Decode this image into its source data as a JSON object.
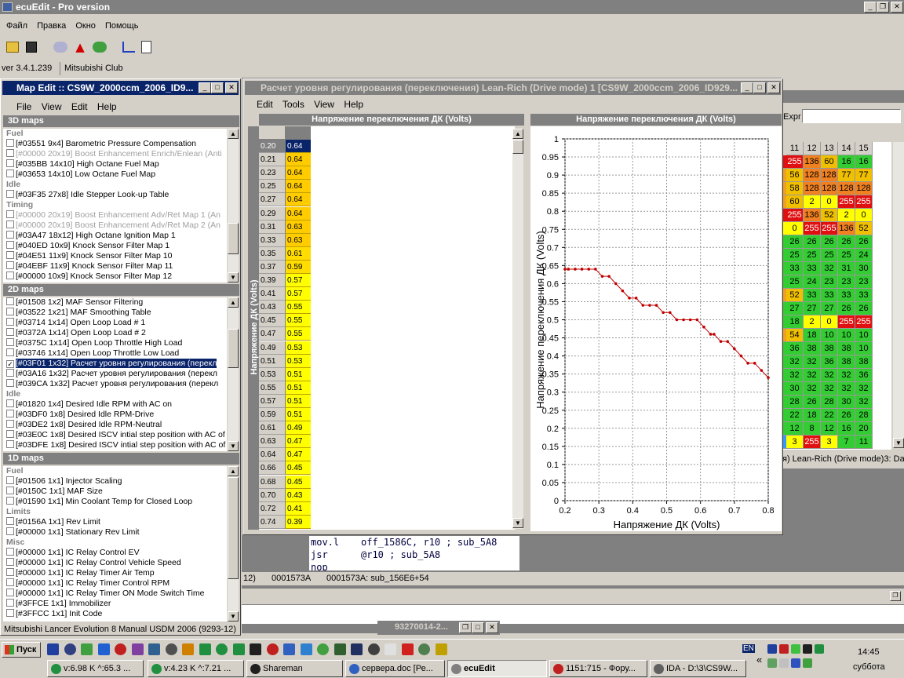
{
  "app": {
    "title": "ecuEdit - Pro version",
    "menu": [
      "Файл",
      "Правка",
      "Окно",
      "Помощь"
    ],
    "version": "ver 3.4.1.239",
    "club": "Mitsubishi Club"
  },
  "map_window": {
    "title": "Map Edit :: CS9W_2000ccm_2006_ID9...",
    "menu": [
      "File",
      "View",
      "Edit",
      "Help"
    ],
    "sections": {
      "s3d": "3D maps",
      "s2d": "2D maps",
      "s1d": "1D maps"
    },
    "maps3d": [
      {
        "g": "Fuel"
      },
      {
        "t": "[#03551 9x4] Barometric Pressure Compensation"
      },
      {
        "t": "[#00000 20x19] Boost Enhancement Enrich/Enlean (Anti",
        "d": true
      },
      {
        "t": "[#035BB 14x10] High Octane Fuel Map"
      },
      {
        "t": "[#03653 14x10] Low Octane Fuel Map"
      },
      {
        "g": "Idle"
      },
      {
        "t": "[#03F35 27x8] Idle Stepper Look-up Table"
      },
      {
        "g": "Timing"
      },
      {
        "t": "[#00000 20x19] Boost Enhancement Adv/Ret Map 1 (An",
        "d": true
      },
      {
        "t": "[#00000 20x19] Boost Enhancement Adv/Ret Map 2 (An",
        "d": true
      },
      {
        "t": "[#03A47 18x12] High Octane Ignition Map 1"
      },
      {
        "t": "[#040ED 10x9] Knock Sensor Filter Map 1"
      },
      {
        "t": "[#04E51 11x9] Knock Sensor Filter Map 10"
      },
      {
        "t": "[#04EBF 11x9] Knock Sensor Filter Map 11"
      },
      {
        "t": "[#00000 10x9] Knock Sensor Filter Map 12"
      }
    ],
    "maps2d": [
      {
        "t": "[#01508 1x2] MAF Sensor Filtering"
      },
      {
        "t": "[#03522 1x21] MAF Smoothing Table"
      },
      {
        "t": "[#03714 1x14] Open Loop Load # 1"
      },
      {
        "t": "[#0372A 1x14] Open Loop Load # 2"
      },
      {
        "t": "[#0375C 1x14] Open Loop Throttle High Load"
      },
      {
        "t": "[#03746 1x14] Open Loop Throttle Low Load"
      },
      {
        "t": "[#03F01 1x32] Расчет уровня регулирования (перекл",
        "c": true,
        "s": true
      },
      {
        "t": "[#03A16 1x32] Расчет уровня регулирования (перекл"
      },
      {
        "t": "[#039CA 1x32] Расчет уровня регулирования (перекл"
      },
      {
        "g": "Idle"
      },
      {
        "t": "[#01820 1x4] Desired Idle RPM with AC on"
      },
      {
        "t": "[#03DF0 1x8] Desired Idle RPM-Drive"
      },
      {
        "t": "[#03DE2 1x8] Desired Idle RPM-Neutral"
      },
      {
        "t": "[#03E0C 1x8] Desired ISCV intial step position with AC of"
      },
      {
        "t": "[#03DFE 1x8] Desired ISCV intial step position with AC of"
      }
    ],
    "maps1d": [
      {
        "g": "Fuel"
      },
      {
        "t": "[#01506 1x1] Injector Scaling"
      },
      {
        "t": "[#0150C 1x1] MAF Size"
      },
      {
        "t": "[#01590 1x1] Min Coolant Temp for Closed Loop"
      },
      {
        "g": "Limits"
      },
      {
        "t": "[#0156A 1x1] Rev Limit"
      },
      {
        "t": "[#00000 1x1] Stationary Rev Limit"
      },
      {
        "g": "Misc"
      },
      {
        "t": "[#00000 1x1] IC Relay Control EV"
      },
      {
        "t": "[#00000 1x1] IC Relay Control Vehicle Speed"
      },
      {
        "t": "[#00000 1x1] IC Relay Timer Air Temp"
      },
      {
        "t": "[#00000 1x1] IC Relay Timer Control RPM"
      },
      {
        "t": "[#00000 1x1] IC Relay Timer ON Mode Switch Time"
      },
      {
        "t": "[#3FFCE 1x1] Immobilizer"
      },
      {
        "t": "[#3FFCC 1x1] Init Code"
      }
    ],
    "status": "Mitsubishi Lancer Evolution 8 Manual USDM 2006 (9293-12)"
  },
  "main_window": {
    "title": "Расчет уровня регулирования (переключения) Lean-Rich (Drive mode) 1 [CS9W_2000ccm_2006_ID929...",
    "menu": [
      "Edit",
      "Tools",
      "View",
      "Help"
    ],
    "table_header": "Напряжение переключения ДК (Volts)",
    "row_axis_label": "Напряжение ДК (Volts)",
    "rows": [
      [
        "0.20",
        "0.64"
      ],
      [
        "0.21",
        "0.64"
      ],
      [
        "0.23",
        "0.64"
      ],
      [
        "0.25",
        "0.64"
      ],
      [
        "0.27",
        "0.64"
      ],
      [
        "0.29",
        "0.64"
      ],
      [
        "0.31",
        "0.63"
      ],
      [
        "0.33",
        "0.63"
      ],
      [
        "0.35",
        "0.61"
      ],
      [
        "0.37",
        "0.59"
      ],
      [
        "0.39",
        "0.57"
      ],
      [
        "0.41",
        "0.57"
      ],
      [
        "0.43",
        "0.55"
      ],
      [
        "0.45",
        "0.55"
      ],
      [
        "0.47",
        "0.55"
      ],
      [
        "0.49",
        "0.53"
      ],
      [
        "0.51",
        "0.53"
      ],
      [
        "0.53",
        "0.51"
      ],
      [
        "0.55",
        "0.51"
      ],
      [
        "0.57",
        "0.51"
      ],
      [
        "0.59",
        "0.51"
      ],
      [
        "0.61",
        "0.49"
      ],
      [
        "0.63",
        "0.47"
      ],
      [
        "0.64",
        "0.47"
      ],
      [
        "0.66",
        "0.45"
      ],
      [
        "0.68",
        "0.45"
      ],
      [
        "0.70",
        "0.43"
      ],
      [
        "0.72",
        "0.41"
      ],
      [
        "0.74",
        "0.39"
      ]
    ]
  },
  "chart_data": {
    "type": "line",
    "title": "Напряжение переключения ДК (Volts)",
    "xlabel": "Напряжение ДК (Volts)",
    "ylabel": "Напряжение переключения ДК (Volts)",
    "xlim": [
      0.2,
      0.8
    ],
    "ylim": [
      0,
      1
    ],
    "grid": true,
    "xticks": [
      "0.2",
      "0.3",
      "0.4",
      "0.5",
      "0.6",
      "0.7",
      "0.8"
    ],
    "yticks": [
      "0",
      "0.05",
      "0.1",
      "0.15",
      "0.2",
      "0.25",
      "0.3",
      "0.35",
      "0.4",
      "0.45",
      "0.5",
      "0.55",
      "0.6",
      "0.65",
      "0.7",
      "0.75",
      "0.8",
      "0.85",
      "0.9",
      "0.95",
      "1"
    ],
    "x": [
      0.2,
      0.21,
      0.23,
      0.25,
      0.27,
      0.29,
      0.31,
      0.33,
      0.35,
      0.37,
      0.39,
      0.41,
      0.43,
      0.45,
      0.47,
      0.49,
      0.51,
      0.53,
      0.55,
      0.57,
      0.59,
      0.61,
      0.63,
      0.64,
      0.66,
      0.68,
      0.7,
      0.72,
      0.74,
      0.76,
      0.78,
      0.8
    ],
    "y": [
      0.64,
      0.64,
      0.64,
      0.64,
      0.64,
      0.64,
      0.62,
      0.62,
      0.6,
      0.58,
      0.56,
      0.56,
      0.54,
      0.54,
      0.54,
      0.52,
      0.52,
      0.5,
      0.5,
      0.5,
      0.5,
      0.48,
      0.46,
      0.46,
      0.44,
      0.44,
      0.42,
      0.4,
      0.38,
      0.38,
      0.36,
      0.34
    ],
    "line_color": "#c00000"
  },
  "hex_grid": {
    "cols": [
      "11",
      "12",
      "13",
      "14",
      "15"
    ],
    "rows": [
      [
        "255",
        "136",
        "60",
        "16",
        "16"
      ],
      [
        "56",
        "128",
        "128",
        "77",
        "77"
      ],
      [
        "58",
        "128",
        "128",
        "128",
        "128"
      ],
      [
        "60",
        "2",
        "0",
        "255",
        "255"
      ],
      [
        "255",
        "136",
        "52",
        "2",
        "0"
      ],
      [
        "0",
        "255",
        "255",
        "136",
        "52"
      ],
      [
        "26",
        "26",
        "26",
        "26",
        "26"
      ],
      [
        "25",
        "25",
        "25",
        "25",
        "24"
      ],
      [
        "33",
        "33",
        "32",
        "31",
        "30"
      ],
      [
        "25",
        "24",
        "23",
        "23",
        "23"
      ],
      [
        "52",
        "33",
        "33",
        "33",
        "33"
      ],
      [
        "27",
        "27",
        "27",
        "26",
        "26"
      ],
      [
        "18",
        "2",
        "0",
        "255",
        "255"
      ],
      [
        "54",
        "18",
        "10",
        "10",
        "10"
      ],
      [
        "36",
        "38",
        "38",
        "38",
        "10"
      ],
      [
        "32",
        "32",
        "36",
        "38",
        "38"
      ],
      [
        "32",
        "32",
        "32",
        "32",
        "36"
      ],
      [
        "30",
        "32",
        "32",
        "32",
        "32"
      ],
      [
        "28",
        "26",
        "28",
        "30",
        "32"
      ],
      [
        "22",
        "18",
        "22",
        "26",
        "28"
      ],
      [
        "12",
        "8",
        "12",
        "16",
        "20"
      ],
      [
        "3",
        "255",
        "3",
        "7",
        "11"
      ]
    ],
    "left_colors": [
      "#e01010",
      "#f0a020",
      "#f0a020",
      "#f0a020",
      "#e01010",
      "#ffff00",
      "#33cc33",
      "#33cc33",
      "#33cc33",
      "#33cc33",
      "#f0a020",
      "#33cc33",
      "#33cc33",
      "#f0a020",
      "#33cc33",
      "#33cc33",
      "#33cc33",
      "#33cc33",
      "#33cc33",
      "#33cc33",
      "#33cc33",
      "#3399ff"
    ],
    "expr_label": "Expr",
    "caption": "я) Lean-Rich (Drive mode)3: Da"
  },
  "disasm": {
    "lines": [
      [
        "mov.l",
        "off_1586C, r10 ; sub_5A8"
      ],
      [
        "jsr",
        "@r10 ; sub_5A8"
      ],
      [
        "nop",
        ""
      ]
    ],
    "status": [
      "12)",
      "0001573A",
      "0001573A: sub_156E6+54"
    ]
  },
  "minimized": {
    "title": "93270014-2..."
  },
  "taskbar": {
    "start": "Пуск",
    "lang": "EN",
    "time": "14:45",
    "day": "суббота",
    "tasks": [
      "v:6.98 K ^:65.3 ...",
      "v:4.23 K ^:7.21 ...",
      "Shareman",
      "сервера.doc [Ре...",
      "ecuEdit",
      "1151:715 - Фору...",
      "IDA - D:\\3\\CS9W..."
    ]
  }
}
